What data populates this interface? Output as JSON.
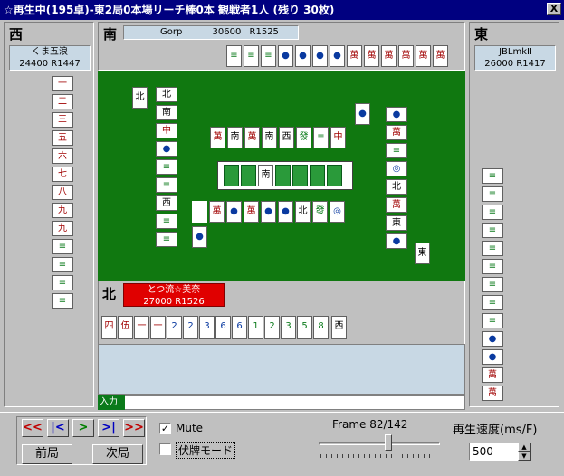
{
  "window": {
    "title": "☆再生中(195卓)-東2局0本場リーチ棒0本 観戦者1人 (残り 30枚)",
    "close_label": "X"
  },
  "seats": {
    "west": {
      "label": "西",
      "name": "くま五浪",
      "score": "24400",
      "rate": "R1447"
    },
    "south": {
      "label": "南",
      "name": "Gorp",
      "score": "30600",
      "rate": "R1525"
    },
    "east": {
      "label": "東",
      "name": "JBLmkⅡ",
      "score": "26000",
      "rate": "R1417"
    },
    "north": {
      "label": "北",
      "name": "とつ流☆美奈",
      "score": "27000",
      "rate": "R1526"
    }
  },
  "board": {
    "round_wind": "南"
  },
  "north_hand": [
    "四萬",
    "伍萬",
    "一萬",
    "一萬",
    "2筒",
    "2筒",
    "3筒",
    "6筒",
    "6筒",
    "1索",
    "2索",
    "3索",
    "5索",
    "8索",
    "西"
  ],
  "input": {
    "label": "入力"
  },
  "controls": {
    "nav_buttons": [
      "<<",
      "|<",
      ">",
      ">|",
      ">>"
    ],
    "prev_round": "前局",
    "next_round": "次局",
    "mute_label": "Mute",
    "mute_checked": true,
    "hidden_mode_label": "伏牌モード",
    "hidden_mode_checked": false,
    "frame_label": "Frame 82/142",
    "frame_progress": 0.58,
    "speed_label": "再生速度(ms/F)",
    "speed_value": "500"
  },
  "colors": {
    "title_bar": "#000080",
    "board": "#107810",
    "dealer_highlight": "#e00000",
    "info_bg": "#c8d8e4"
  }
}
